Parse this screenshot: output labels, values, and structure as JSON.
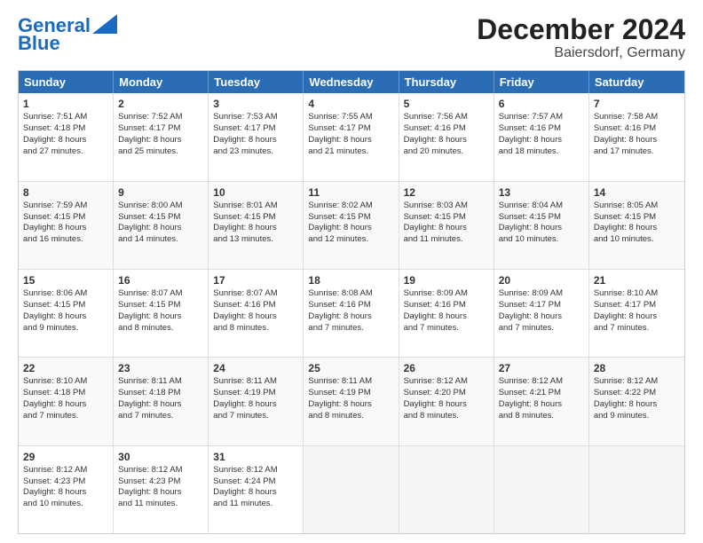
{
  "logo": {
    "part1": "General",
    "part2": "Blue"
  },
  "title": "December 2024",
  "subtitle": "Baiersdorf, Germany",
  "header_days": [
    "Sunday",
    "Monday",
    "Tuesday",
    "Wednesday",
    "Thursday",
    "Friday",
    "Saturday"
  ],
  "weeks": [
    [
      {
        "day": "1",
        "lines": [
          "Sunrise: 7:51 AM",
          "Sunset: 4:18 PM",
          "Daylight: 8 hours",
          "and 27 minutes."
        ]
      },
      {
        "day": "2",
        "lines": [
          "Sunrise: 7:52 AM",
          "Sunset: 4:17 PM",
          "Daylight: 8 hours",
          "and 25 minutes."
        ]
      },
      {
        "day": "3",
        "lines": [
          "Sunrise: 7:53 AM",
          "Sunset: 4:17 PM",
          "Daylight: 8 hours",
          "and 23 minutes."
        ]
      },
      {
        "day": "4",
        "lines": [
          "Sunrise: 7:55 AM",
          "Sunset: 4:17 PM",
          "Daylight: 8 hours",
          "and 21 minutes."
        ]
      },
      {
        "day": "5",
        "lines": [
          "Sunrise: 7:56 AM",
          "Sunset: 4:16 PM",
          "Daylight: 8 hours",
          "and 20 minutes."
        ]
      },
      {
        "day": "6",
        "lines": [
          "Sunrise: 7:57 AM",
          "Sunset: 4:16 PM",
          "Daylight: 8 hours",
          "and 18 minutes."
        ]
      },
      {
        "day": "7",
        "lines": [
          "Sunrise: 7:58 AM",
          "Sunset: 4:16 PM",
          "Daylight: 8 hours",
          "and 17 minutes."
        ]
      }
    ],
    [
      {
        "day": "8",
        "lines": [
          "Sunrise: 7:59 AM",
          "Sunset: 4:15 PM",
          "Daylight: 8 hours",
          "and 16 minutes."
        ]
      },
      {
        "day": "9",
        "lines": [
          "Sunrise: 8:00 AM",
          "Sunset: 4:15 PM",
          "Daylight: 8 hours",
          "and 14 minutes."
        ]
      },
      {
        "day": "10",
        "lines": [
          "Sunrise: 8:01 AM",
          "Sunset: 4:15 PM",
          "Daylight: 8 hours",
          "and 13 minutes."
        ]
      },
      {
        "day": "11",
        "lines": [
          "Sunrise: 8:02 AM",
          "Sunset: 4:15 PM",
          "Daylight: 8 hours",
          "and 12 minutes."
        ]
      },
      {
        "day": "12",
        "lines": [
          "Sunrise: 8:03 AM",
          "Sunset: 4:15 PM",
          "Daylight: 8 hours",
          "and 11 minutes."
        ]
      },
      {
        "day": "13",
        "lines": [
          "Sunrise: 8:04 AM",
          "Sunset: 4:15 PM",
          "Daylight: 8 hours",
          "and 10 minutes."
        ]
      },
      {
        "day": "14",
        "lines": [
          "Sunrise: 8:05 AM",
          "Sunset: 4:15 PM",
          "Daylight: 8 hours",
          "and 10 minutes."
        ]
      }
    ],
    [
      {
        "day": "15",
        "lines": [
          "Sunrise: 8:06 AM",
          "Sunset: 4:15 PM",
          "Daylight: 8 hours",
          "and 9 minutes."
        ]
      },
      {
        "day": "16",
        "lines": [
          "Sunrise: 8:07 AM",
          "Sunset: 4:15 PM",
          "Daylight: 8 hours",
          "and 8 minutes."
        ]
      },
      {
        "day": "17",
        "lines": [
          "Sunrise: 8:07 AM",
          "Sunset: 4:16 PM",
          "Daylight: 8 hours",
          "and 8 minutes."
        ]
      },
      {
        "day": "18",
        "lines": [
          "Sunrise: 8:08 AM",
          "Sunset: 4:16 PM",
          "Daylight: 8 hours",
          "and 7 minutes."
        ]
      },
      {
        "day": "19",
        "lines": [
          "Sunrise: 8:09 AM",
          "Sunset: 4:16 PM",
          "Daylight: 8 hours",
          "and 7 minutes."
        ]
      },
      {
        "day": "20",
        "lines": [
          "Sunrise: 8:09 AM",
          "Sunset: 4:17 PM",
          "Daylight: 8 hours",
          "and 7 minutes."
        ]
      },
      {
        "day": "21",
        "lines": [
          "Sunrise: 8:10 AM",
          "Sunset: 4:17 PM",
          "Daylight: 8 hours",
          "and 7 minutes."
        ]
      }
    ],
    [
      {
        "day": "22",
        "lines": [
          "Sunrise: 8:10 AM",
          "Sunset: 4:18 PM",
          "Daylight: 8 hours",
          "and 7 minutes."
        ]
      },
      {
        "day": "23",
        "lines": [
          "Sunrise: 8:11 AM",
          "Sunset: 4:18 PM",
          "Daylight: 8 hours",
          "and 7 minutes."
        ]
      },
      {
        "day": "24",
        "lines": [
          "Sunrise: 8:11 AM",
          "Sunset: 4:19 PM",
          "Daylight: 8 hours",
          "and 7 minutes."
        ]
      },
      {
        "day": "25",
        "lines": [
          "Sunrise: 8:11 AM",
          "Sunset: 4:19 PM",
          "Daylight: 8 hours",
          "and 8 minutes."
        ]
      },
      {
        "day": "26",
        "lines": [
          "Sunrise: 8:12 AM",
          "Sunset: 4:20 PM",
          "Daylight: 8 hours",
          "and 8 minutes."
        ]
      },
      {
        "day": "27",
        "lines": [
          "Sunrise: 8:12 AM",
          "Sunset: 4:21 PM",
          "Daylight: 8 hours",
          "and 8 minutes."
        ]
      },
      {
        "day": "28",
        "lines": [
          "Sunrise: 8:12 AM",
          "Sunset: 4:22 PM",
          "Daylight: 8 hours",
          "and 9 minutes."
        ]
      }
    ],
    [
      {
        "day": "29",
        "lines": [
          "Sunrise: 8:12 AM",
          "Sunset: 4:23 PM",
          "Daylight: 8 hours",
          "and 10 minutes."
        ]
      },
      {
        "day": "30",
        "lines": [
          "Sunrise: 8:12 AM",
          "Sunset: 4:23 PM",
          "Daylight: 8 hours",
          "and 11 minutes."
        ]
      },
      {
        "day": "31",
        "lines": [
          "Sunrise: 8:12 AM",
          "Sunset: 4:24 PM",
          "Daylight: 8 hours",
          "and 11 minutes."
        ]
      },
      null,
      null,
      null,
      null
    ]
  ]
}
